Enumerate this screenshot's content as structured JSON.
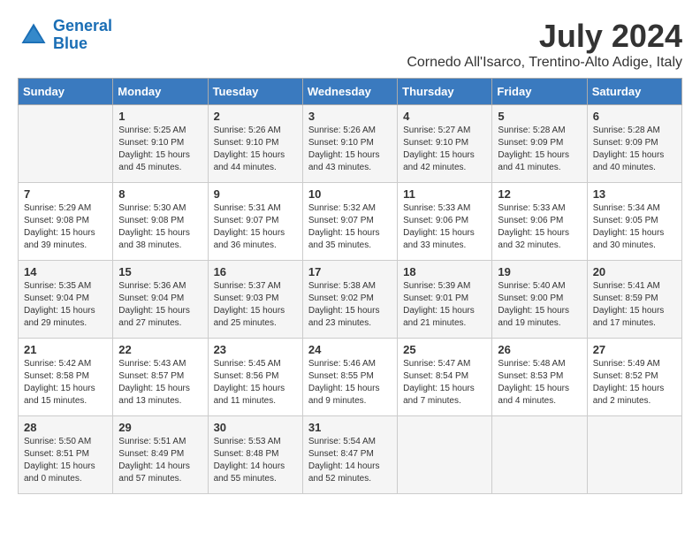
{
  "logo": {
    "line1": "General",
    "line2": "Blue"
  },
  "title": "July 2024",
  "location": "Cornedo All'Isarco, Trentino-Alto Adige, Italy",
  "days_of_week": [
    "Sunday",
    "Monday",
    "Tuesday",
    "Wednesday",
    "Thursday",
    "Friday",
    "Saturday"
  ],
  "weeks": [
    [
      {
        "day": "",
        "info": ""
      },
      {
        "day": "1",
        "info": "Sunrise: 5:25 AM\nSunset: 9:10 PM\nDaylight: 15 hours\nand 45 minutes."
      },
      {
        "day": "2",
        "info": "Sunrise: 5:26 AM\nSunset: 9:10 PM\nDaylight: 15 hours\nand 44 minutes."
      },
      {
        "day": "3",
        "info": "Sunrise: 5:26 AM\nSunset: 9:10 PM\nDaylight: 15 hours\nand 43 minutes."
      },
      {
        "day": "4",
        "info": "Sunrise: 5:27 AM\nSunset: 9:10 PM\nDaylight: 15 hours\nand 42 minutes."
      },
      {
        "day": "5",
        "info": "Sunrise: 5:28 AM\nSunset: 9:09 PM\nDaylight: 15 hours\nand 41 minutes."
      },
      {
        "day": "6",
        "info": "Sunrise: 5:28 AM\nSunset: 9:09 PM\nDaylight: 15 hours\nand 40 minutes."
      }
    ],
    [
      {
        "day": "7",
        "info": "Sunrise: 5:29 AM\nSunset: 9:08 PM\nDaylight: 15 hours\nand 39 minutes."
      },
      {
        "day": "8",
        "info": "Sunrise: 5:30 AM\nSunset: 9:08 PM\nDaylight: 15 hours\nand 38 minutes."
      },
      {
        "day": "9",
        "info": "Sunrise: 5:31 AM\nSunset: 9:07 PM\nDaylight: 15 hours\nand 36 minutes."
      },
      {
        "day": "10",
        "info": "Sunrise: 5:32 AM\nSunset: 9:07 PM\nDaylight: 15 hours\nand 35 minutes."
      },
      {
        "day": "11",
        "info": "Sunrise: 5:33 AM\nSunset: 9:06 PM\nDaylight: 15 hours\nand 33 minutes."
      },
      {
        "day": "12",
        "info": "Sunrise: 5:33 AM\nSunset: 9:06 PM\nDaylight: 15 hours\nand 32 minutes."
      },
      {
        "day": "13",
        "info": "Sunrise: 5:34 AM\nSunset: 9:05 PM\nDaylight: 15 hours\nand 30 minutes."
      }
    ],
    [
      {
        "day": "14",
        "info": "Sunrise: 5:35 AM\nSunset: 9:04 PM\nDaylight: 15 hours\nand 29 minutes."
      },
      {
        "day": "15",
        "info": "Sunrise: 5:36 AM\nSunset: 9:04 PM\nDaylight: 15 hours\nand 27 minutes."
      },
      {
        "day": "16",
        "info": "Sunrise: 5:37 AM\nSunset: 9:03 PM\nDaylight: 15 hours\nand 25 minutes."
      },
      {
        "day": "17",
        "info": "Sunrise: 5:38 AM\nSunset: 9:02 PM\nDaylight: 15 hours\nand 23 minutes."
      },
      {
        "day": "18",
        "info": "Sunrise: 5:39 AM\nSunset: 9:01 PM\nDaylight: 15 hours\nand 21 minutes."
      },
      {
        "day": "19",
        "info": "Sunrise: 5:40 AM\nSunset: 9:00 PM\nDaylight: 15 hours\nand 19 minutes."
      },
      {
        "day": "20",
        "info": "Sunrise: 5:41 AM\nSunset: 8:59 PM\nDaylight: 15 hours\nand 17 minutes."
      }
    ],
    [
      {
        "day": "21",
        "info": "Sunrise: 5:42 AM\nSunset: 8:58 PM\nDaylight: 15 hours\nand 15 minutes."
      },
      {
        "day": "22",
        "info": "Sunrise: 5:43 AM\nSunset: 8:57 PM\nDaylight: 15 hours\nand 13 minutes."
      },
      {
        "day": "23",
        "info": "Sunrise: 5:45 AM\nSunset: 8:56 PM\nDaylight: 15 hours\nand 11 minutes."
      },
      {
        "day": "24",
        "info": "Sunrise: 5:46 AM\nSunset: 8:55 PM\nDaylight: 15 hours\nand 9 minutes."
      },
      {
        "day": "25",
        "info": "Sunrise: 5:47 AM\nSunset: 8:54 PM\nDaylight: 15 hours\nand 7 minutes."
      },
      {
        "day": "26",
        "info": "Sunrise: 5:48 AM\nSunset: 8:53 PM\nDaylight: 15 hours\nand 4 minutes."
      },
      {
        "day": "27",
        "info": "Sunrise: 5:49 AM\nSunset: 8:52 PM\nDaylight: 15 hours\nand 2 minutes."
      }
    ],
    [
      {
        "day": "28",
        "info": "Sunrise: 5:50 AM\nSunset: 8:51 PM\nDaylight: 15 hours\nand 0 minutes."
      },
      {
        "day": "29",
        "info": "Sunrise: 5:51 AM\nSunset: 8:49 PM\nDaylight: 14 hours\nand 57 minutes."
      },
      {
        "day": "30",
        "info": "Sunrise: 5:53 AM\nSunset: 8:48 PM\nDaylight: 14 hours\nand 55 minutes."
      },
      {
        "day": "31",
        "info": "Sunrise: 5:54 AM\nSunset: 8:47 PM\nDaylight: 14 hours\nand 52 minutes."
      },
      {
        "day": "",
        "info": ""
      },
      {
        "day": "",
        "info": ""
      },
      {
        "day": "",
        "info": ""
      }
    ]
  ]
}
